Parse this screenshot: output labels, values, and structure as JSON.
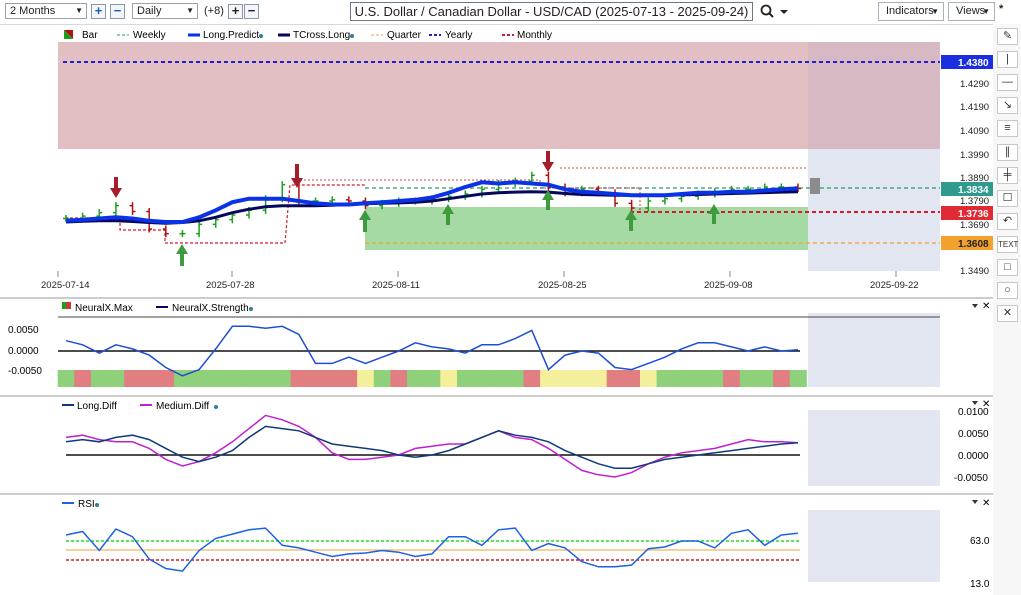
{
  "toolbar": {
    "period": "2 Months",
    "interval": "Daily",
    "offset": "(+8)",
    "title": "U.S. Dollar / Canadian Dollar - USD/CAD (2025-07-13 - 2025-09-24)",
    "indicators": "Indicators",
    "views": "Views",
    "star": "*"
  },
  "legend": {
    "bar": "Bar",
    "weekly": "Weekly",
    "long_predict": "Long.Predict",
    "tcross_long": "TCross.Long",
    "quarter": "Quarter",
    "yearly": "Yearly",
    "monthly": "Monthly"
  },
  "price_axis": [
    "1.4290",
    "1.4190",
    "1.4090",
    "1.3990",
    "1.3890",
    "1.3790",
    "1.3690",
    "1.3490"
  ],
  "price_tags": {
    "yearly": "1.4380",
    "last": "1.3834",
    "monthly": "1.3736",
    "quarter": "1.3608"
  },
  "date_axis": [
    "2025-07-14",
    "2025-07-28",
    "2025-08-11",
    "2025-08-25",
    "2025-09-08",
    "2025-09-22"
  ],
  "neural": {
    "label_max": "NeuralX.Max",
    "label_strength": "NeuralX.Strength",
    "ticks": [
      "0.0050",
      "0.0000",
      "-0.0050"
    ]
  },
  "diff": {
    "label_long": "Long.Diff",
    "label_medium": "Medium.Diff",
    "ticks": [
      "0.0100",
      "0.0050",
      "0.0000",
      "-0.0050"
    ]
  },
  "rsi": {
    "label": "RSI",
    "ticks": [
      "63.0",
      "13.0"
    ]
  },
  "side_tools": [
    "pencil-icon",
    "vline-icon",
    "hline-icon",
    "ray-icon",
    "fib-icon",
    "channel-icon",
    "note-icon",
    "undo-icon",
    "text-icon",
    "square-icon",
    "circle-icon",
    "close-icon"
  ],
  "colors": {
    "up": "#1aa01a",
    "down": "#b01010",
    "long_predict": "#0a32e6",
    "tcross": "#06065c",
    "yearly": "#2020d0",
    "monthly": "#d01c2c",
    "quarter": "#f0a030",
    "weekly": "#2a9a6a",
    "support": "#7cd07c",
    "resistance": "#d89aa2"
  },
  "chart_data": [
    {
      "type": "line",
      "title": "U.S. Dollar / Canadian Dollar - USD/CAD (2025-07-13 - 2025-09-24)",
      "xlabel": "",
      "ylabel": "",
      "x": [
        "2025-07-14",
        "2025-07-15",
        "2025-07-16",
        "2025-07-17",
        "2025-07-18",
        "2025-07-21",
        "2025-07-22",
        "2025-07-23",
        "2025-07-24",
        "2025-07-25",
        "2025-07-28",
        "2025-07-29",
        "2025-07-30",
        "2025-07-31",
        "2025-08-01",
        "2025-08-04",
        "2025-08-05",
        "2025-08-06",
        "2025-08-07",
        "2025-08-08",
        "2025-08-11",
        "2025-08-12",
        "2025-08-13",
        "2025-08-14",
        "2025-08-15",
        "2025-08-18",
        "2025-08-19",
        "2025-08-20",
        "2025-08-21",
        "2025-08-22",
        "2025-08-25",
        "2025-08-26",
        "2025-08-27",
        "2025-08-28",
        "2025-08-29",
        "2025-09-01",
        "2025-09-02",
        "2025-09-03",
        "2025-09-04",
        "2025-09-05",
        "2025-09-08",
        "2025-09-09",
        "2025-09-10",
        "2025-09-11",
        "2025-09-12"
      ],
      "ylim": [
        1.348,
        1.447
      ],
      "series": [
        {
          "name": "Bar",
          "values": [
            1.3705,
            1.3715,
            1.373,
            1.376,
            1.3735,
            1.366,
            1.364,
            1.364,
            1.368,
            1.37,
            1.372,
            1.374,
            1.379,
            1.385,
            1.378,
            1.378,
            1.3785,
            1.378,
            1.376,
            1.377,
            1.378,
            1.378,
            1.379,
            1.38,
            1.381,
            1.383,
            1.3855,
            1.3865,
            1.389,
            1.384,
            1.3815,
            1.383,
            1.3815,
            1.377,
            1.375,
            1.378,
            1.379,
            1.38,
            1.381,
            1.382,
            1.383,
            1.383,
            1.384,
            1.384,
            1.3834
          ]
        },
        {
          "name": "Long.Predict",
          "values": [
            1.3695,
            1.37,
            1.3705,
            1.371,
            1.3705,
            1.3695,
            1.369,
            1.369,
            1.371,
            1.374,
            1.3775,
            1.379,
            1.379,
            1.379,
            1.378,
            1.377,
            1.3765,
            1.3765,
            1.377,
            1.3775,
            1.378,
            1.3785,
            1.3795,
            1.3815,
            1.384,
            1.386,
            1.3855,
            1.386,
            1.3855,
            1.385,
            1.383,
            1.382,
            1.3815,
            1.381,
            1.3805,
            1.3805,
            1.3805,
            1.381,
            1.3815,
            1.3815,
            1.382,
            1.382,
            1.3825,
            1.383,
            1.3834
          ]
        },
        {
          "name": "TCross.Long",
          "values": [
            1.369,
            1.3693,
            1.3695,
            1.3695,
            1.3692,
            1.3688,
            1.3685,
            1.3688,
            1.3695,
            1.371,
            1.373,
            1.3745,
            1.3755,
            1.376,
            1.376,
            1.376,
            1.3762,
            1.3765,
            1.3768,
            1.377,
            1.3772,
            1.3775,
            1.378,
            1.379,
            1.38,
            1.381,
            1.3815,
            1.3818,
            1.382,
            1.3818,
            1.3812,
            1.3808,
            1.3806,
            1.3805,
            1.3804,
            1.3804,
            1.3804,
            1.3806,
            1.3808,
            1.381,
            1.3812,
            1.3814,
            1.3816,
            1.3818,
            1.382
          ]
        }
      ],
      "levels": {
        "Yearly": 1.438,
        "Monthly": 1.3736,
        "Quarter": 1.3608
      },
      "price_axis_ticks": [
        "1.4290",
        "1.4190",
        "1.4090",
        "1.3990",
        "1.3890",
        "1.3790",
        "1.3690",
        "1.3490"
      ],
      "x_ticks": [
        "2025-07-14",
        "2025-07-28",
        "2025-08-11",
        "2025-08-25",
        "2025-09-08",
        "2025-09-22"
      ]
    },
    {
      "type": "line",
      "title": "",
      "series": [
        {
          "name": "NeuralX.Strength",
          "values": [
            0.0025,
            0.0015,
            -0.0005,
            0.0015,
            0.0005,
            -0.001,
            -0.004,
            -0.006,
            -0.0045,
            0.0005,
            0.006,
            0.006,
            0.0055,
            0.006,
            0.004,
            -0.003,
            -0.003,
            -0.0015,
            -0.003,
            -0.0015,
            0.0,
            0.002,
            0.001,
            0.0005,
            -0.0005,
            0.0015,
            0.0015,
            0.003,
            0.005,
            -0.0045,
            -0.001,
            0.0,
            -0.0005,
            -0.004,
            -0.0045,
            -0.003,
            -0.0015,
            0.0005,
            0.002,
            0.002,
            0.001,
            0.0,
            0.001,
            0.0,
            0.0003
          ]
        },
        {
          "name": "NeuralX.Max",
          "values": [
            1,
            -1,
            1,
            1,
            -1,
            -1,
            -1,
            1,
            1,
            1,
            1,
            1,
            1,
            1,
            -1,
            -1,
            -1,
            -1,
            0,
            1,
            -1,
            1,
            1,
            0,
            1,
            1,
            1,
            1,
            -1,
            0,
            0,
            0,
            0,
            -1,
            -1,
            0,
            1,
            1,
            1,
            1,
            -1,
            1,
            1,
            -1,
            1
          ]
        }
      ],
      "ylim": [
        -0.008,
        0.008
      ]
    },
    {
      "type": "line",
      "title": "",
      "series": [
        {
          "name": "Long.Diff",
          "values": [
            0.003,
            0.0035,
            0.003,
            0.004,
            0.0045,
            0.0035,
            0.0015,
            -0.0005,
            -0.0015,
            -0.0005,
            0.001,
            0.004,
            0.0065,
            0.006,
            0.0055,
            0.004,
            0.0025,
            0.002,
            0.0015,
            0.001,
            0.0,
            -0.0005,
            0.0,
            0.001,
            0.0025,
            0.004,
            0.0055,
            0.0045,
            0.004,
            0.003,
            0.001,
            -0.0005,
            -0.002,
            -0.003,
            -0.003,
            -0.002,
            -0.001,
            -0.0005,
            0.0,
            0.0005,
            0.001,
            0.0015,
            0.002,
            0.0025,
            0.0028
          ]
        },
        {
          "name": "Medium.Diff",
          "values": [
            0.004,
            0.0045,
            0.0035,
            0.003,
            0.003,
            0.0015,
            -0.001,
            -0.0025,
            -0.0015,
            0.0005,
            0.003,
            0.006,
            0.009,
            0.008,
            0.0065,
            0.004,
            0.0005,
            -0.001,
            -0.001,
            -0.0005,
            0.0,
            0.0015,
            0.002,
            0.0025,
            0.0025,
            0.004,
            0.0055,
            0.004,
            0.0035,
            0.0015,
            -0.001,
            -0.0035,
            -0.0045,
            -0.005,
            -0.004,
            -0.002,
            -0.0005,
            0.0005,
            0.001,
            0.0015,
            0.0025,
            0.0035,
            0.003,
            0.003,
            0.0028
          ]
        }
      ],
      "ylim": [
        -0.007,
        0.0105
      ]
    },
    {
      "type": "line",
      "title": "",
      "series": [
        {
          "name": "RSI",
          "values": [
            70,
            74,
            52,
            77,
            68,
            42,
            31,
            28,
            52,
            66,
            71,
            76,
            78,
            58,
            55,
            50,
            45,
            48,
            49,
            52,
            50,
            45,
            48,
            68,
            68,
            58,
            76,
            78,
            52,
            60,
            55,
            39,
            33,
            33,
            35,
            54,
            56,
            63,
            63,
            55,
            72,
            76,
            58,
            70,
            72
          ]
        }
      ],
      "levels": {
        "upper": 63.0,
        "lower": 48.0
      },
      "ylim": [
        12,
        93
      ],
      "ticks": [
        "63.0",
        "13.0"
      ]
    }
  ]
}
